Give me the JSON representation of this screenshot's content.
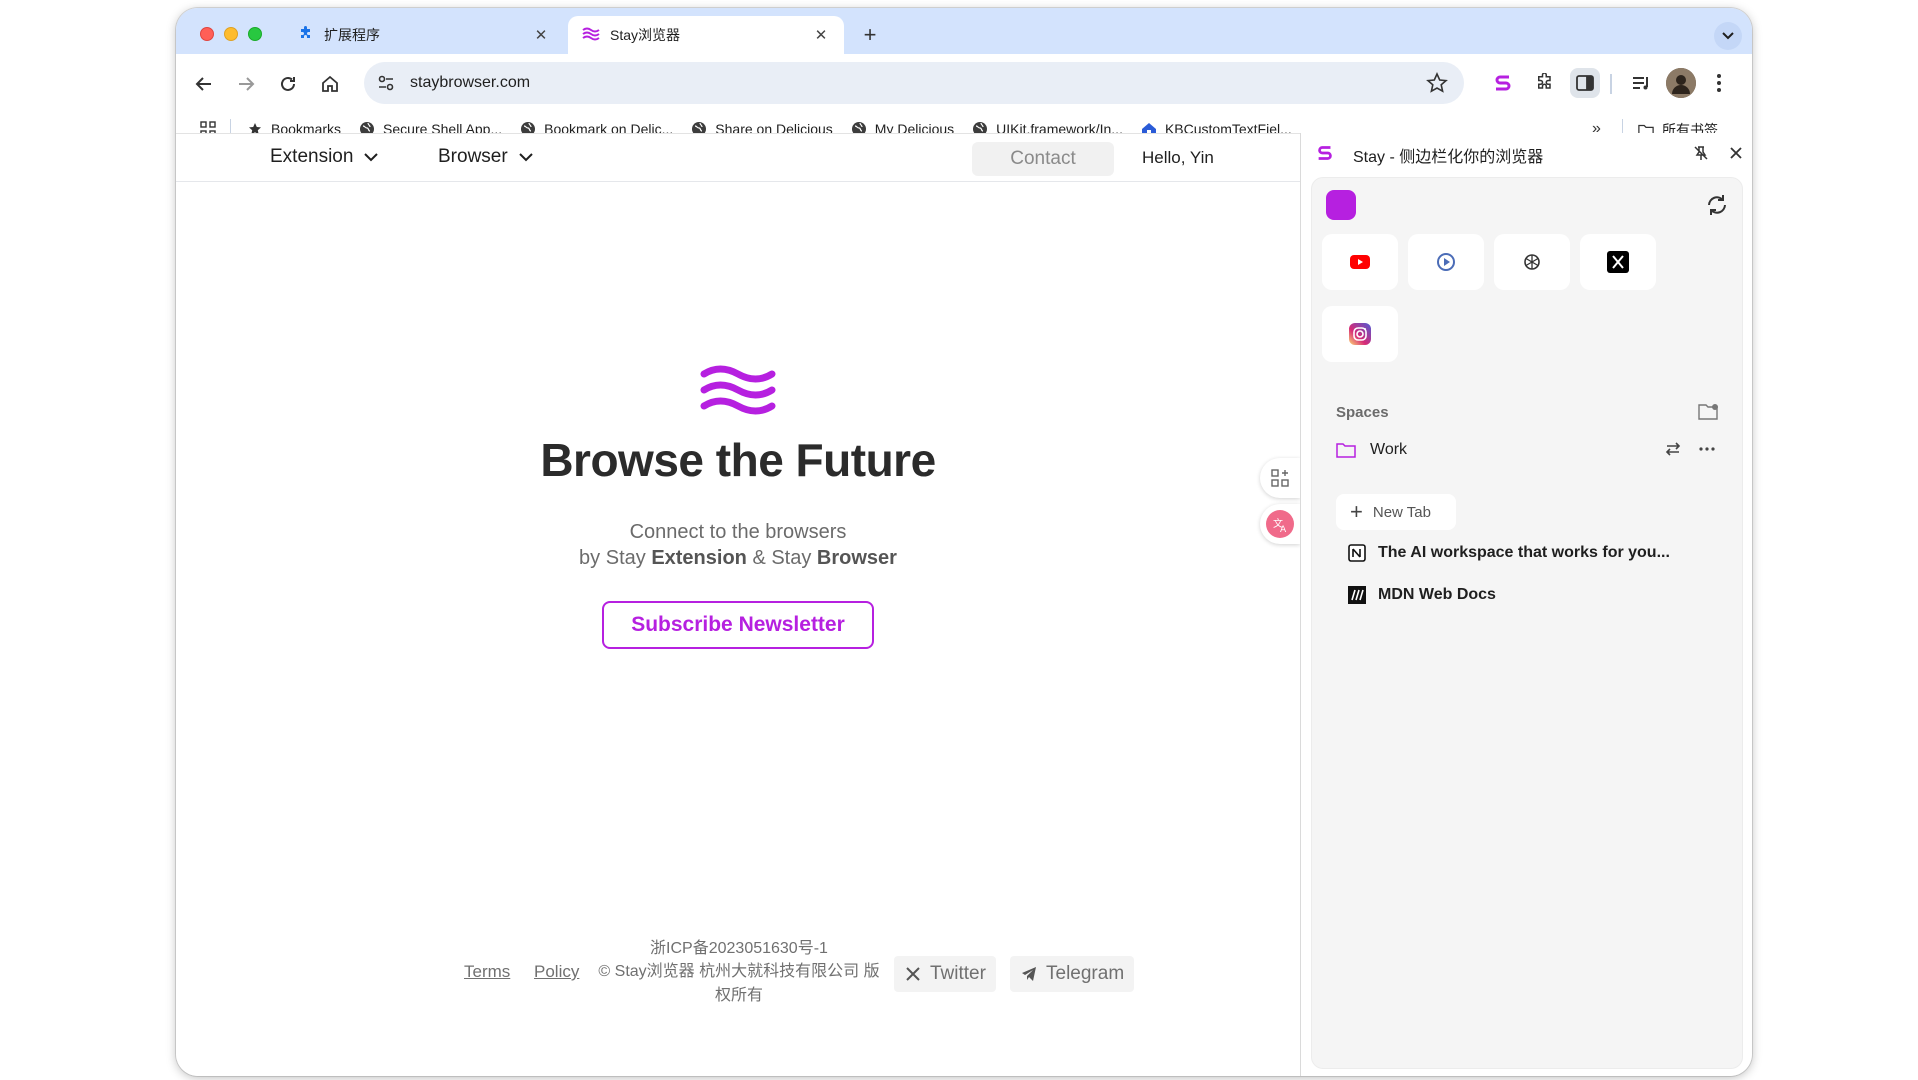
{
  "browser": {
    "tabs": [
      {
        "title": "扩展程序",
        "icon": "puzzle-icon"
      },
      {
        "title": "Stay浏览器",
        "icon": "stay-waves-icon"
      }
    ],
    "url": "staybrowser.com",
    "bookmarks": [
      {
        "label": "Bookmarks",
        "icon": "star-icon"
      },
      {
        "label": "Secure Shell App...",
        "icon": "globe-icon"
      },
      {
        "label": "Bookmark on Delic...",
        "icon": "globe-icon"
      },
      {
        "label": "Share on Delicious",
        "icon": "globe-icon"
      },
      {
        "label": "My Delicious",
        "icon": "globe-icon"
      },
      {
        "label": "UIKit.framework/In...",
        "icon": "globe-icon"
      },
      {
        "label": "KBCustomTextFiel...",
        "icon": "house-icon"
      }
    ],
    "all_bookmarks": "所有书签"
  },
  "site": {
    "nav": {
      "extension": "Extension",
      "browser": "Browser",
      "contact": "Contact",
      "hello": "Hello, Yin"
    },
    "hero": {
      "title": "Browse the Future",
      "line1": "Connect to the browsers",
      "line2_prefix": "by Stay ",
      "line2_bold1": "Extension",
      "line2_mid": " & Stay ",
      "line2_bold2": "Browser",
      "subscribe": "Subscribe Newsletter"
    },
    "footer": {
      "icp": "浙ICP备2023051630号-1",
      "terms": "Terms",
      "policy": "Policy",
      "copyright": "© Stay浏览器 杭州大就科技有限公司 版权所有",
      "twitter": "Twitter",
      "telegram": "Telegram"
    }
  },
  "sidepanel": {
    "title": "Stay - 侧边栏化你的浏览器",
    "shortcuts": [
      "youtube-icon",
      "video-player-icon",
      "openai-icon",
      "x-icon",
      "instagram-icon"
    ],
    "spaces_label": "Spaces",
    "space": "Work",
    "new_tab": "New Tab",
    "tabs": [
      {
        "title": "The AI workspace that works for you...",
        "icon": "notion-icon"
      },
      {
        "title": "MDN Web Docs",
        "icon": "mdn-icon"
      }
    ]
  },
  "colors": {
    "accent": "#b620e0",
    "tabstrip": "#d3e3fd",
    "omnibox": "#e9eef6"
  }
}
